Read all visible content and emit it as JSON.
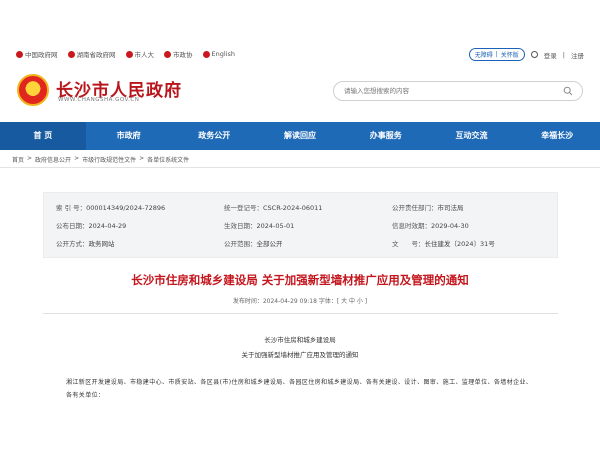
{
  "top_links": [
    "中国政府网",
    "湖南省政府网",
    "市人大",
    "市政协",
    "English"
  ],
  "accessibility": {
    "barrier_free": "无障碍",
    "care_mode": "关怀版"
  },
  "login": "登录",
  "register": "注册",
  "site": {
    "title": "长沙市人民政府",
    "domain": "WWW.CHANGSHA.GOV.CN"
  },
  "search": {
    "placeholder": "请输入您想搜索的内容"
  },
  "nav": [
    "首    页",
    "市政府",
    "政务公开",
    "解读回应",
    "办事服务",
    "互动交流",
    "幸福长沙"
  ],
  "breadcrumb": [
    "首页",
    "政府信息公开",
    "市级行政规范性文件",
    "各单位系统文件"
  ],
  "breadcrumb_sep": ">",
  "meta": {
    "index_label": "索 引 号：",
    "index": "000014349/2024-72896",
    "unified_label": "统一登记号：",
    "unified": "CSCR-2024-06011",
    "resp_label": "公开责任部门：",
    "resp": "市司法局",
    "pub_date_label": "公布日期：",
    "pub_date": "2024-04-29",
    "effective_label": "生效日期：",
    "effective": "2024-05-01",
    "expire_label": "信息时效期：",
    "expire": "2029-04-30",
    "method_label": "公开方式：",
    "method": "政务网站",
    "scope_label": "公开范围：",
    "scope": "全部公开",
    "doc_no_label": "文　　号：",
    "doc_no": "长住建发〔2024〕31号"
  },
  "article": {
    "title": "长沙市住房和城乡建设局 关于加强新型墙材推广应用及管理的通知",
    "info": "发布时间：2024-04-29 09:18  字体：[ 大 中 小 ]",
    "org": "长沙市住房和城乡建设局",
    "subtitle": "关于加强新型墙材推广应用及管理的通知",
    "body": "湘江新区开发建设局、市稳建中心、市质安站、各区县(市)住房和城乡建设局、各园区住房和城乡建设局、各有关建设、设计、图审、施工、监理单位、各墙材企业、各有关单位："
  },
  "colors": {
    "nav_bg": "#1e6ab7",
    "title_red": "#c4151c",
    "brand_red": "#b8161b"
  }
}
